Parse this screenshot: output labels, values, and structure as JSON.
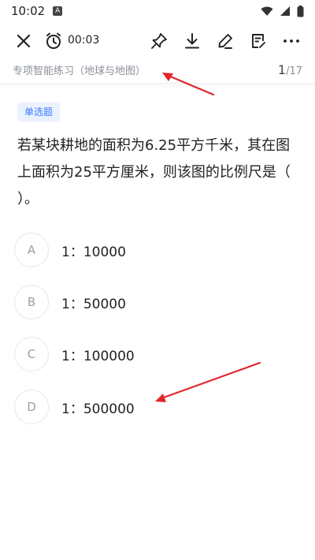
{
  "status_bar": {
    "time": "10:02",
    "notification_glyph": "A",
    "icons": [
      "wifi-icon",
      "signal-icon",
      "battery-icon"
    ]
  },
  "toolbar": {
    "timer": "00:03",
    "icons": [
      "close-icon",
      "timer-icon",
      "pin-icon",
      "download-icon",
      "edit-icon",
      "note-icon",
      "more-icon"
    ]
  },
  "breadcrumb": {
    "title": "专项智能练习（地球与地图）",
    "current": "1",
    "total": "/17"
  },
  "question": {
    "type_tag": "单选题",
    "text": "若某块耕地的面积为6.25平方千米，其在图上面积为25平方厘米，则该图的比例尺是（ ）。",
    "options": [
      {
        "letter": "A",
        "text": "1：10000"
      },
      {
        "letter": "B",
        "text": "1：50000"
      },
      {
        "letter": "C",
        "text": "1：100000"
      },
      {
        "letter": "D",
        "text": "1：500000"
      }
    ]
  },
  "colors": {
    "accent": "#3a7bff",
    "tag_bg": "#eaf2ff",
    "annotation_red": "#e0262b"
  }
}
